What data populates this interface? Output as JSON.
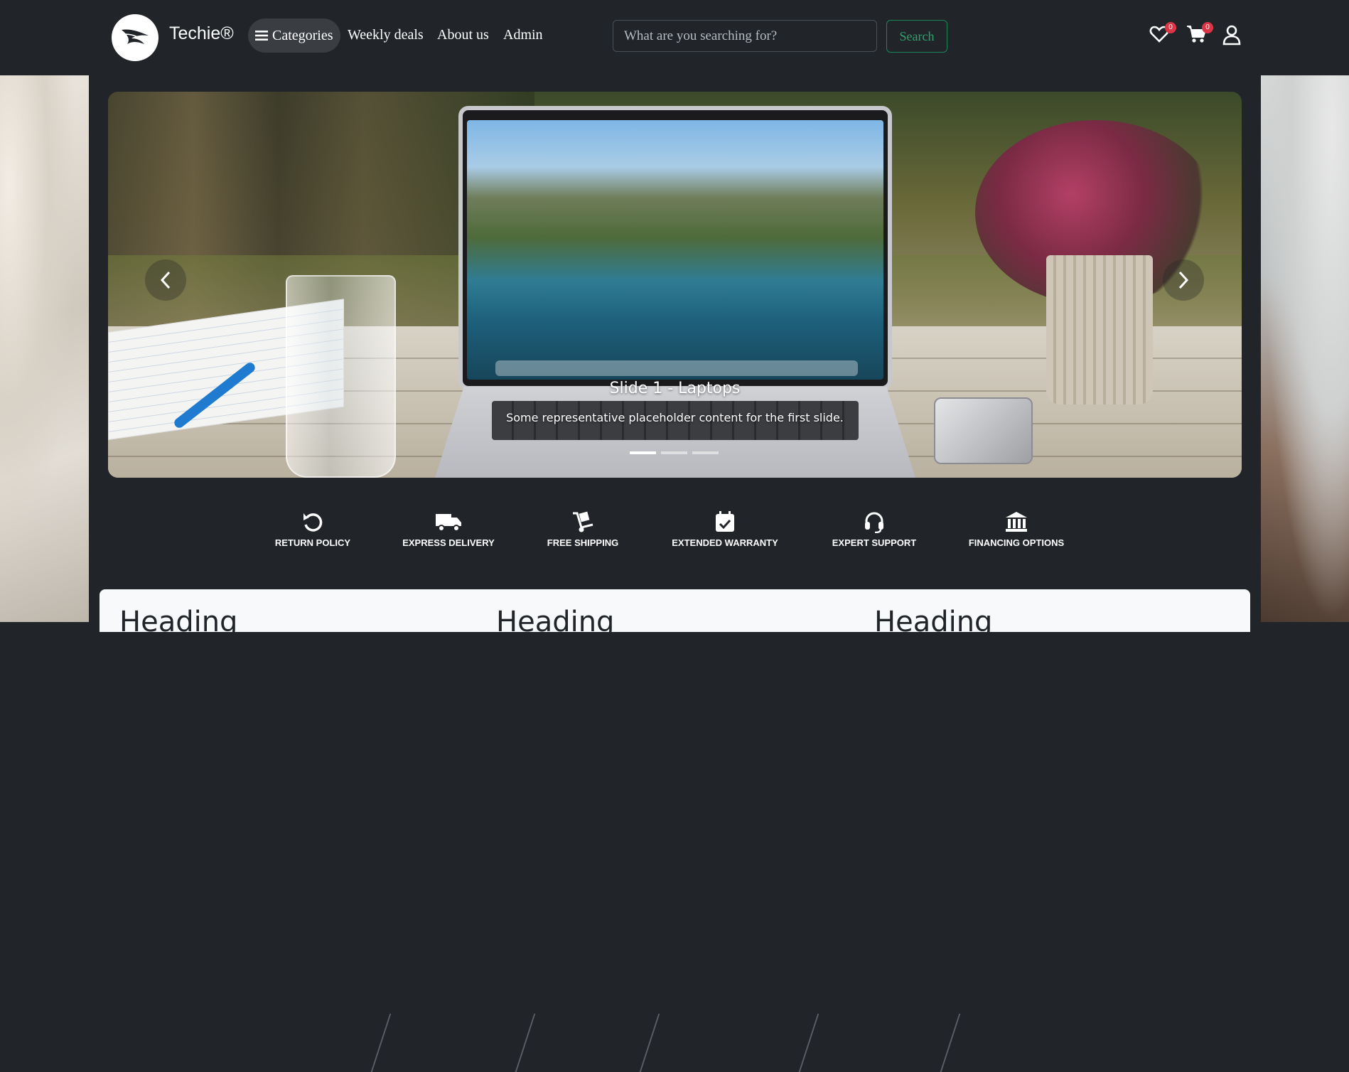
{
  "navbar": {
    "brand": "Techie®",
    "categories_label": "Categories",
    "links": [
      "Weekly deals",
      "About us",
      "Admin"
    ],
    "search_placeholder": "What are you searching for?",
    "search_button": "Search",
    "wishlist_count": "0",
    "cart_count": "0",
    "icons": {
      "logo": "eagle-logo-icon",
      "wishlist": "heart-icon",
      "cart": "cart-icon",
      "user": "person-icon",
      "menu": "hamburger-icon"
    }
  },
  "carousel": {
    "title": "Slide 1 - Laptops",
    "text": "Some representative placeholder content for the first slide.",
    "slide_count": 3,
    "active_index": 0
  },
  "features": [
    {
      "label": "RETURN POLICY",
      "icon": "return-icon"
    },
    {
      "label": "EXPRESS DELIVERY",
      "icon": "truck-icon"
    },
    {
      "label": "FREE SHIPPING",
      "icon": "dolly-icon"
    },
    {
      "label": "EXTENDED WARRANTY",
      "icon": "calendar-check-icon"
    },
    {
      "label": "EXPERT SUPPORT",
      "icon": "headset-icon"
    },
    {
      "label": "FINANCING OPTIONS",
      "icon": "bank-icon"
    }
  ],
  "cards": {
    "headings": [
      "Heading",
      "Heading",
      "Heading"
    ]
  },
  "colors": {
    "background": "#212529",
    "accent_green": "#198754",
    "badge_red": "#dc3545",
    "card": "#f8f9fa"
  }
}
